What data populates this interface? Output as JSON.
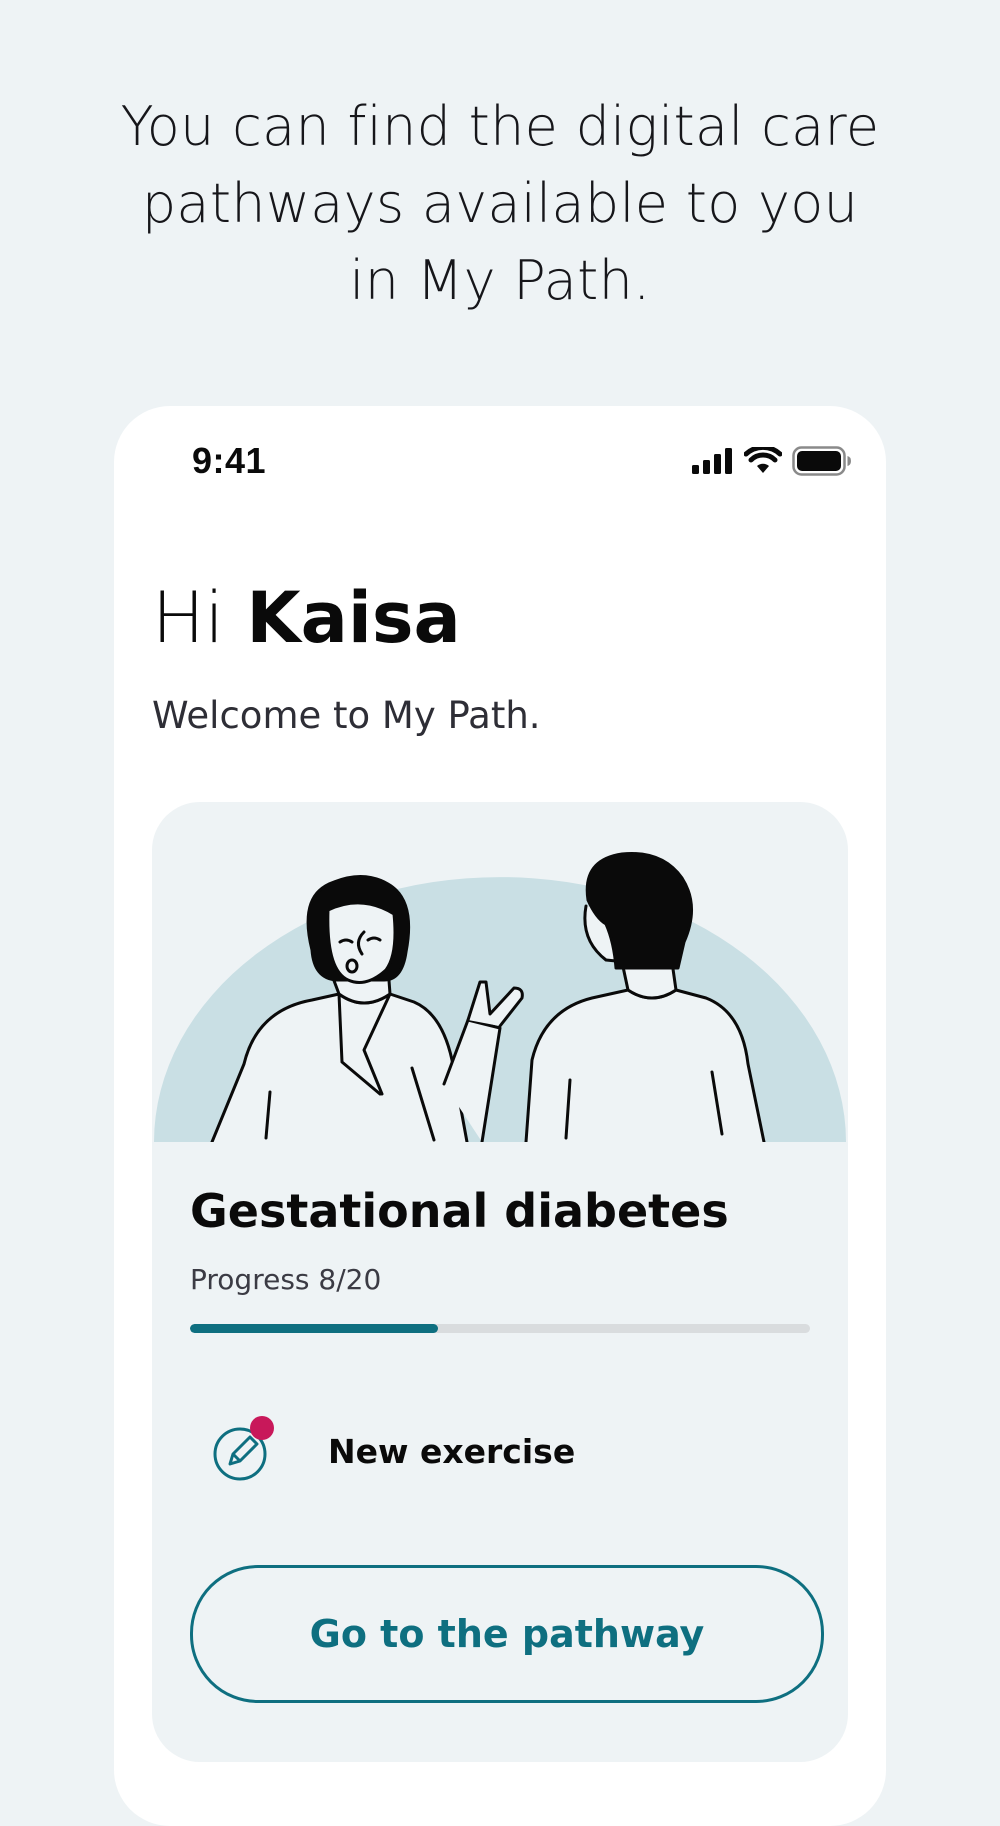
{
  "headline": "You can find the digital care pathways available to you in My Path.",
  "status_bar": {
    "time": "9:41",
    "icons": [
      "cellular-signal-icon",
      "wifi-icon",
      "battery-icon"
    ]
  },
  "greeting": {
    "hi": "Hi",
    "name": "Kaisa"
  },
  "welcome": "Welcome to My Path.",
  "pathway_card": {
    "illustration": "doctor-and-patient-illustration",
    "title": "Gestational diabetes",
    "progress_label": "Progress 8/20",
    "progress": {
      "completed": 8,
      "total": 20
    },
    "exercise_label": "New exercise",
    "exercise_icon": "edit-pencil-icon",
    "button_label": "Go to the pathway"
  },
  "colors": {
    "page_background": "#eef3f5",
    "card_background": "#eef3f5",
    "accent": "#0e6f80",
    "notification_dot": "#c8185a",
    "illustration_arc": "#c9dfe4"
  }
}
